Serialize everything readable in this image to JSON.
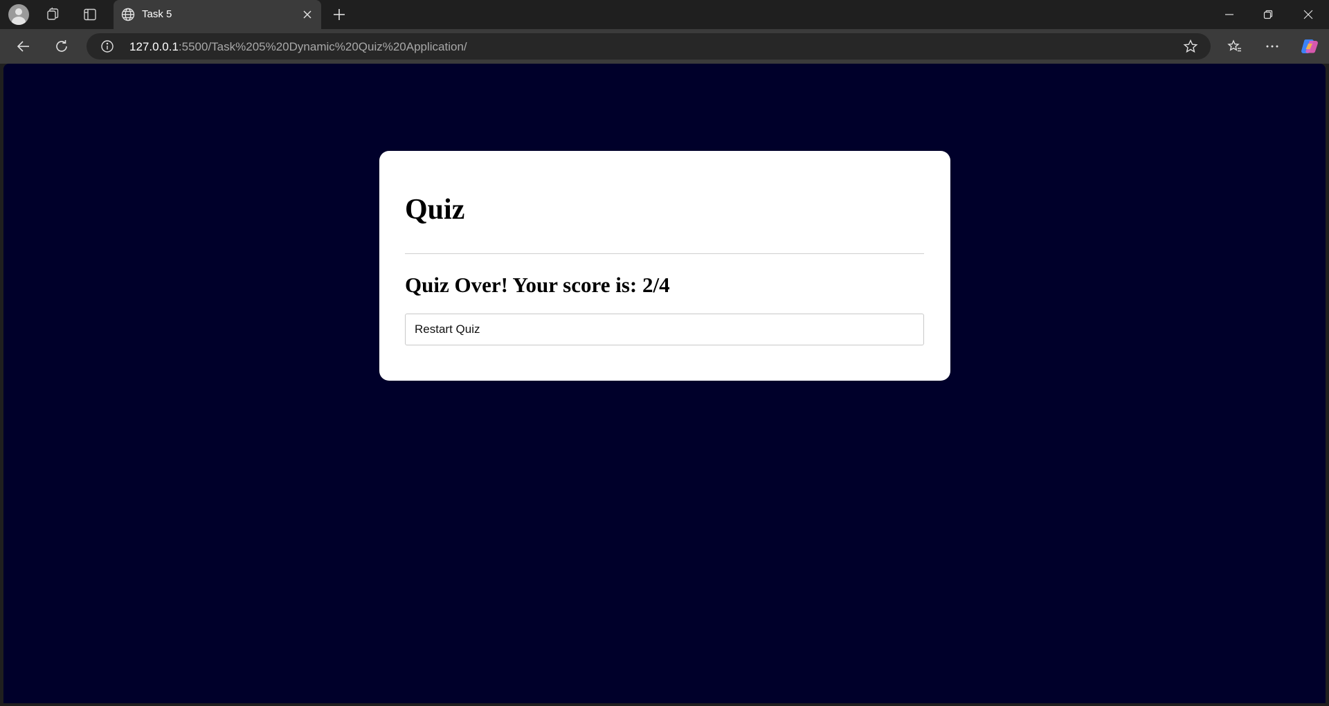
{
  "browser": {
    "tab": {
      "title": "Task 5"
    },
    "address_bar": {
      "host": "127.0.0.1",
      "path": ":5500/Task%205%20Dynamic%20Quiz%20Application/"
    },
    "colors": {
      "frame": "#1f1f1f",
      "toolbar": "#3b3b3b",
      "page_bg": "#00002a"
    },
    "icons": [
      "profile-icon",
      "workspaces-icon",
      "tab-actions-icon",
      "globe-icon",
      "close-icon",
      "plus-icon",
      "minimize-icon",
      "restore-icon",
      "window-close-icon",
      "back-icon",
      "reload-icon",
      "info-icon",
      "star-icon",
      "favorites-icon",
      "more-icon",
      "copilot-icon"
    ]
  },
  "page": {
    "title": "Quiz",
    "result_text": "Quiz Over! Your score is: 2/4",
    "score": {
      "correct": 2,
      "total": 4
    },
    "restart_button_label": "Restart Quiz"
  }
}
